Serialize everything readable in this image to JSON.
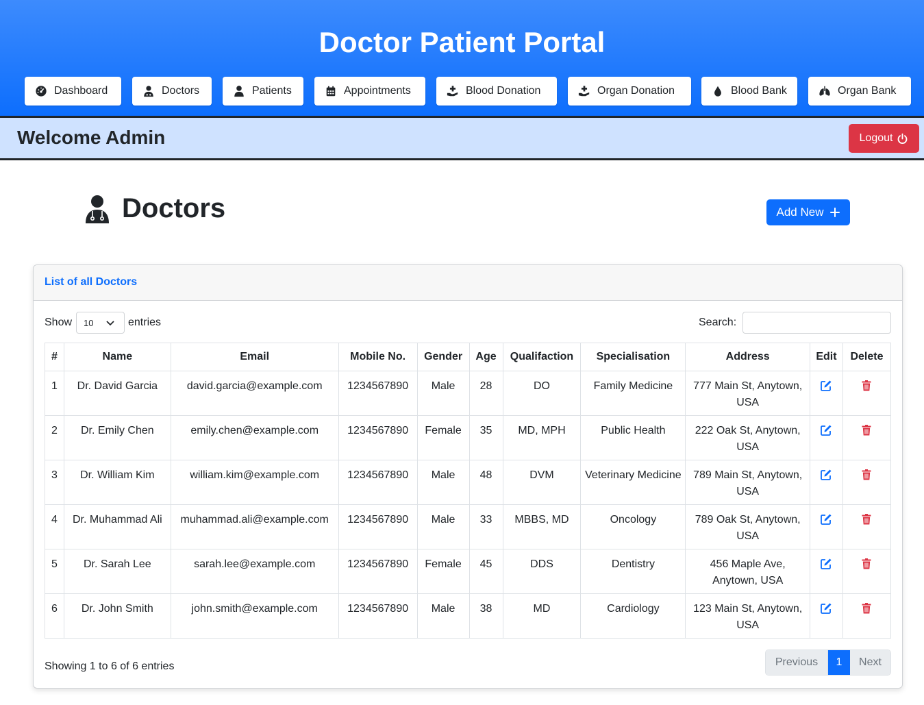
{
  "header": {
    "title": "Doctor Patient Portal",
    "nav": [
      {
        "label": "Dashboard",
        "icon": "gauge-icon"
      },
      {
        "label": "Doctors",
        "icon": "user-doctor-icon"
      },
      {
        "label": "Patients",
        "icon": "user-icon"
      },
      {
        "label": "Appointments",
        "icon": "calendar-icon"
      },
      {
        "label": "Blood Donation",
        "icon": "hand-holding-medical-icon"
      },
      {
        "label": "Organ Donation",
        "icon": "hand-holding-medical-icon"
      },
      {
        "label": "Blood Bank",
        "icon": "droplet-icon"
      },
      {
        "label": "Organ Bank",
        "icon": "lungs-icon"
      }
    ]
  },
  "welcome": {
    "text": "Welcome Admin",
    "logout_label": "Logout",
    "logout_icon": "power-icon"
  },
  "page": {
    "title": "Doctors",
    "title_icon": "user-doctor-icon",
    "add_label": "Add New",
    "add_icon": "plus-icon"
  },
  "card": {
    "title": "List of all Doctors",
    "show_label": "Show",
    "entries_value": "10",
    "entries_label": "entries",
    "search_label": "Search:",
    "search_value": ""
  },
  "table": {
    "columns": [
      "#",
      "Name",
      "Email",
      "Mobile No.",
      "Gender",
      "Age",
      "Qualifaction",
      "Specialisation",
      "Address",
      "Edit",
      "Delete"
    ],
    "rows": [
      {
        "num": "1",
        "name": "Dr. David Garcia",
        "email": "david.garcia@example.com",
        "mobile": "1234567890",
        "gender": "Male",
        "age": "28",
        "qual": "DO",
        "spec": "Family Medicine",
        "addr": "777 Main St, Anytown, USA"
      },
      {
        "num": "2",
        "name": "Dr. Emily Chen",
        "email": "emily.chen@example.com",
        "mobile": "1234567890",
        "gender": "Female",
        "age": "35",
        "qual": "MD, MPH",
        "spec": "Public Health",
        "addr": "222 Oak St, Anytown, USA"
      },
      {
        "num": "3",
        "name": "Dr. William Kim",
        "email": "william.kim@example.com",
        "mobile": "1234567890",
        "gender": "Male",
        "age": "48",
        "qual": "DVM",
        "spec": "Veterinary Medicine",
        "addr": "789 Main St, Anytown, USA"
      },
      {
        "num": "4",
        "name": "Dr. Muhammad Ali",
        "email": "muhammad.ali@example.com",
        "mobile": "1234567890",
        "gender": "Male",
        "age": "33",
        "qual": "MBBS, MD",
        "spec": "Oncology",
        "addr": "789 Oak St, Anytown, USA"
      },
      {
        "num": "5",
        "name": "Dr. Sarah Lee",
        "email": "sarah.lee@example.com",
        "mobile": "1234567890",
        "gender": "Female",
        "age": "45",
        "qual": "DDS",
        "spec": "Dentistry",
        "addr": "456 Maple Ave, Anytown, USA"
      },
      {
        "num": "6",
        "name": "Dr. John Smith",
        "email": "john.smith@example.com",
        "mobile": "1234567890",
        "gender": "Male",
        "age": "38",
        "qual": "MD",
        "spec": "Cardiology",
        "addr": "123 Main St, Anytown, USA"
      }
    ]
  },
  "footer": {
    "showing": "Showing 1 to 6 of 6 entries",
    "previous": "Previous",
    "current_page": "1",
    "next": "Next"
  },
  "colors": {
    "primary": "#0d6efd",
    "danger": "#dc3545",
    "welcome_bg": "#cfe2ff"
  }
}
